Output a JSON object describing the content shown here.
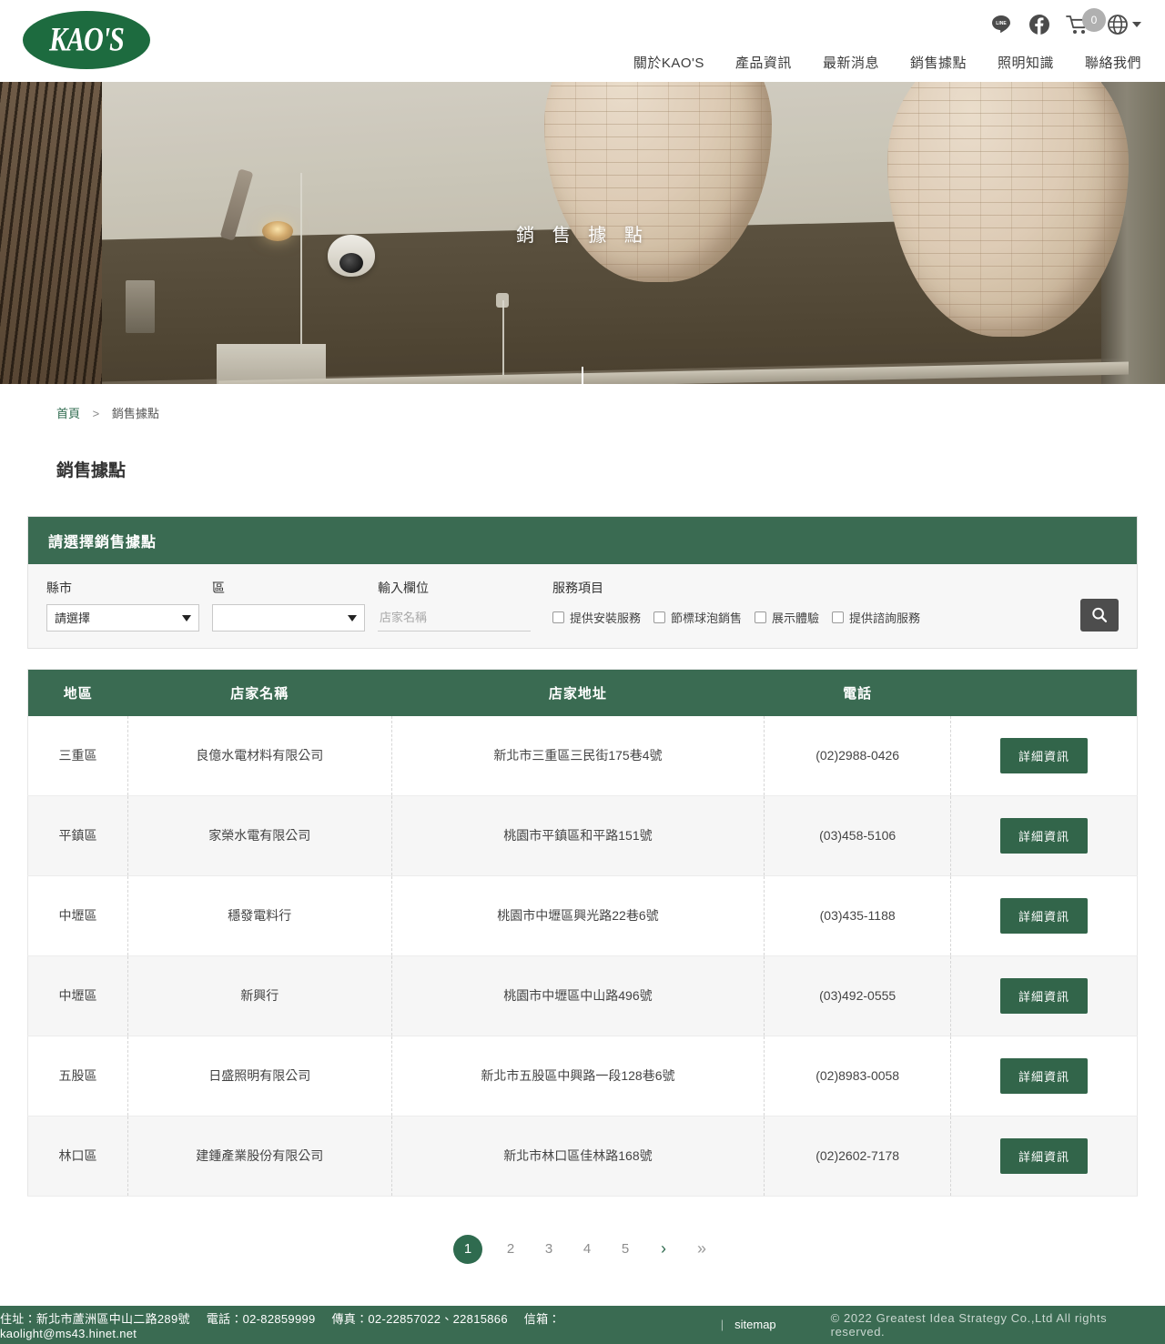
{
  "header": {
    "logo_text": "KAO'S",
    "icons": [
      {
        "name": "line-icon",
        "glyph": "LINE"
      },
      {
        "name": "facebook-icon",
        "glyph": "f"
      },
      {
        "name": "cart-icon",
        "badge": "0"
      },
      {
        "name": "globe-icon",
        "glyph": "⊕"
      }
    ],
    "nav": [
      {
        "label": "關於KAO'S"
      },
      {
        "label": "產品資訊"
      },
      {
        "label": "最新消息"
      },
      {
        "label": "銷售據點"
      },
      {
        "label": "照明知識"
      },
      {
        "label": "聯絡我們"
      }
    ]
  },
  "hero": {
    "title": "銷 售 據 點"
  },
  "breadcrumb": {
    "home": "首頁",
    "separator": ">",
    "current": "銷售據點"
  },
  "page": {
    "title": "銷售據點"
  },
  "filter": {
    "panel_title": "請選擇銷售據點",
    "city": {
      "label": "縣市",
      "value": "請選擇"
    },
    "district": {
      "label": "區",
      "value": ""
    },
    "keyword": {
      "label": "輸入欄位",
      "value": "",
      "placeholder": "店家名稱"
    },
    "services": {
      "label": "服務項目",
      "options": [
        {
          "label": "提供安裝服務",
          "checked": false
        },
        {
          "label": "節標球泡銷售",
          "checked": false
        },
        {
          "label": "展示體驗",
          "checked": false
        },
        {
          "label": "提供諮詢服務",
          "checked": false
        }
      ]
    },
    "search_button": "search-icon"
  },
  "table": {
    "columns": [
      "地區",
      "店家名稱",
      "店家地址",
      "電話"
    ],
    "action_label": "詳細資訊",
    "rows": [
      {
        "area": "三重區",
        "name": "良億水電材料有限公司",
        "address": "新北市三重區三民街175巷4號",
        "tel": "(02)2988-0426"
      },
      {
        "area": "平鎮區",
        "name": "家榮水電有限公司",
        "address": "桃園市平鎮區和平路151號",
        "tel": "(03)458-5106"
      },
      {
        "area": "中壢區",
        "name": "穩發電料行",
        "address": "桃園市中壢區興光路22巷6號",
        "tel": "(03)435-1188"
      },
      {
        "area": "中壢區",
        "name": "新興行",
        "address": "桃園市中壢區中山路496號",
        "tel": "(03)492-0555"
      },
      {
        "area": "五股區",
        "name": "日盛照明有限公司",
        "address": "新北市五股區中興路一段128巷6號",
        "tel": "(02)8983-0058"
      },
      {
        "area": "林口區",
        "name": "建鍾產業股份有限公司",
        "address": "新北市林口區佳林路168號",
        "tel": "(02)2602-7178"
      }
    ]
  },
  "pagination": {
    "pages": [
      "1",
      "2",
      "3",
      "4",
      "5"
    ],
    "active": "1",
    "next": "›",
    "last": "»"
  },
  "footer": {
    "address": "住址：新北市蘆洲區中山二路289號",
    "phone": "電話：02-82859999",
    "fax": "傳真：02-22857022、22815866",
    "email": "信箱：kaolight@ms43.hinet.net",
    "sitemap": "sitemap",
    "copyright": "© 2022 Greatest Idea Strategy Co.,Ltd All rights reserved."
  },
  "colors": {
    "brand_green": "#3a6b52",
    "logo_green": "#1d6b3f",
    "button_green": "#32654a",
    "search_gray": "#4d4d4d"
  }
}
